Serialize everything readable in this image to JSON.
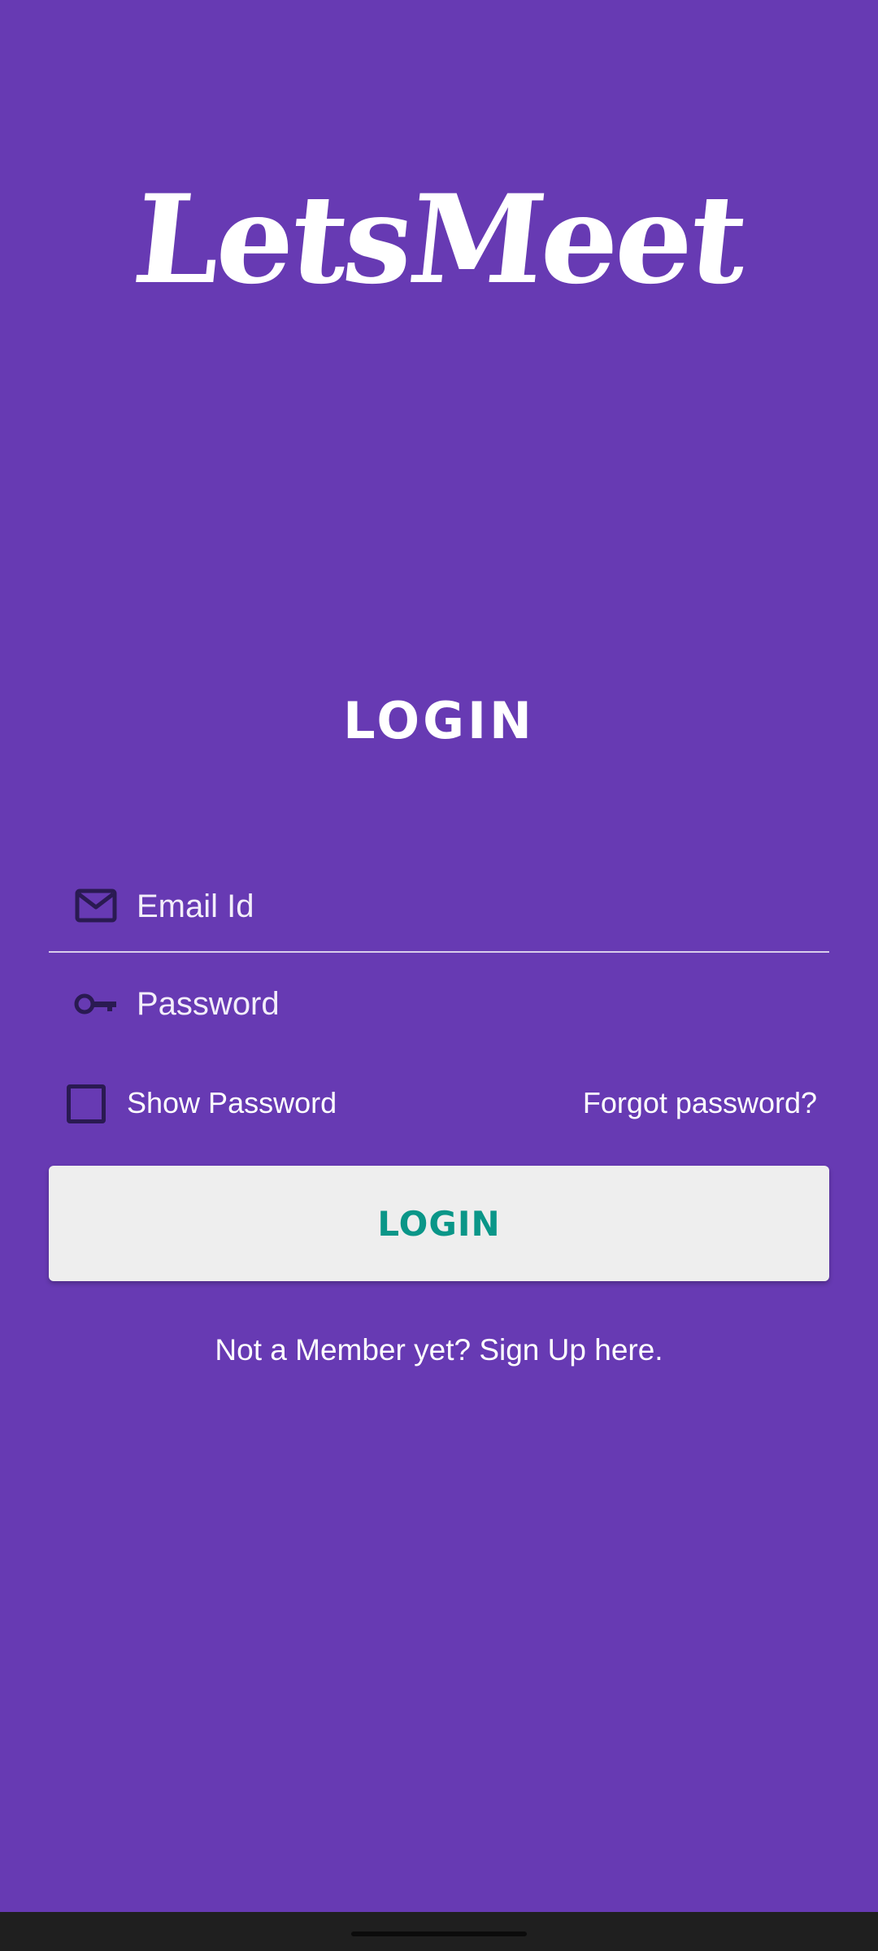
{
  "app": {
    "name": "LetsMeet"
  },
  "login": {
    "heading": "LOGIN",
    "email_placeholder": "Email Id",
    "email_value": "",
    "password_placeholder": "Password",
    "password_value": "",
    "show_password_label": "Show Password",
    "show_password_checked": false,
    "forgot_password_label": "Forgot password?",
    "login_button_label": "LOGIN",
    "signup_text": "Not a Member yet? Sign Up here."
  },
  "icons": {
    "email": "mail-icon",
    "password": "key-icon"
  },
  "colors": {
    "background": "#673AB3",
    "button_bg": "#EEEEEE",
    "button_text": "#0A9688",
    "icon": "#2A1A52",
    "nav_bar": "#1F1F1F"
  }
}
